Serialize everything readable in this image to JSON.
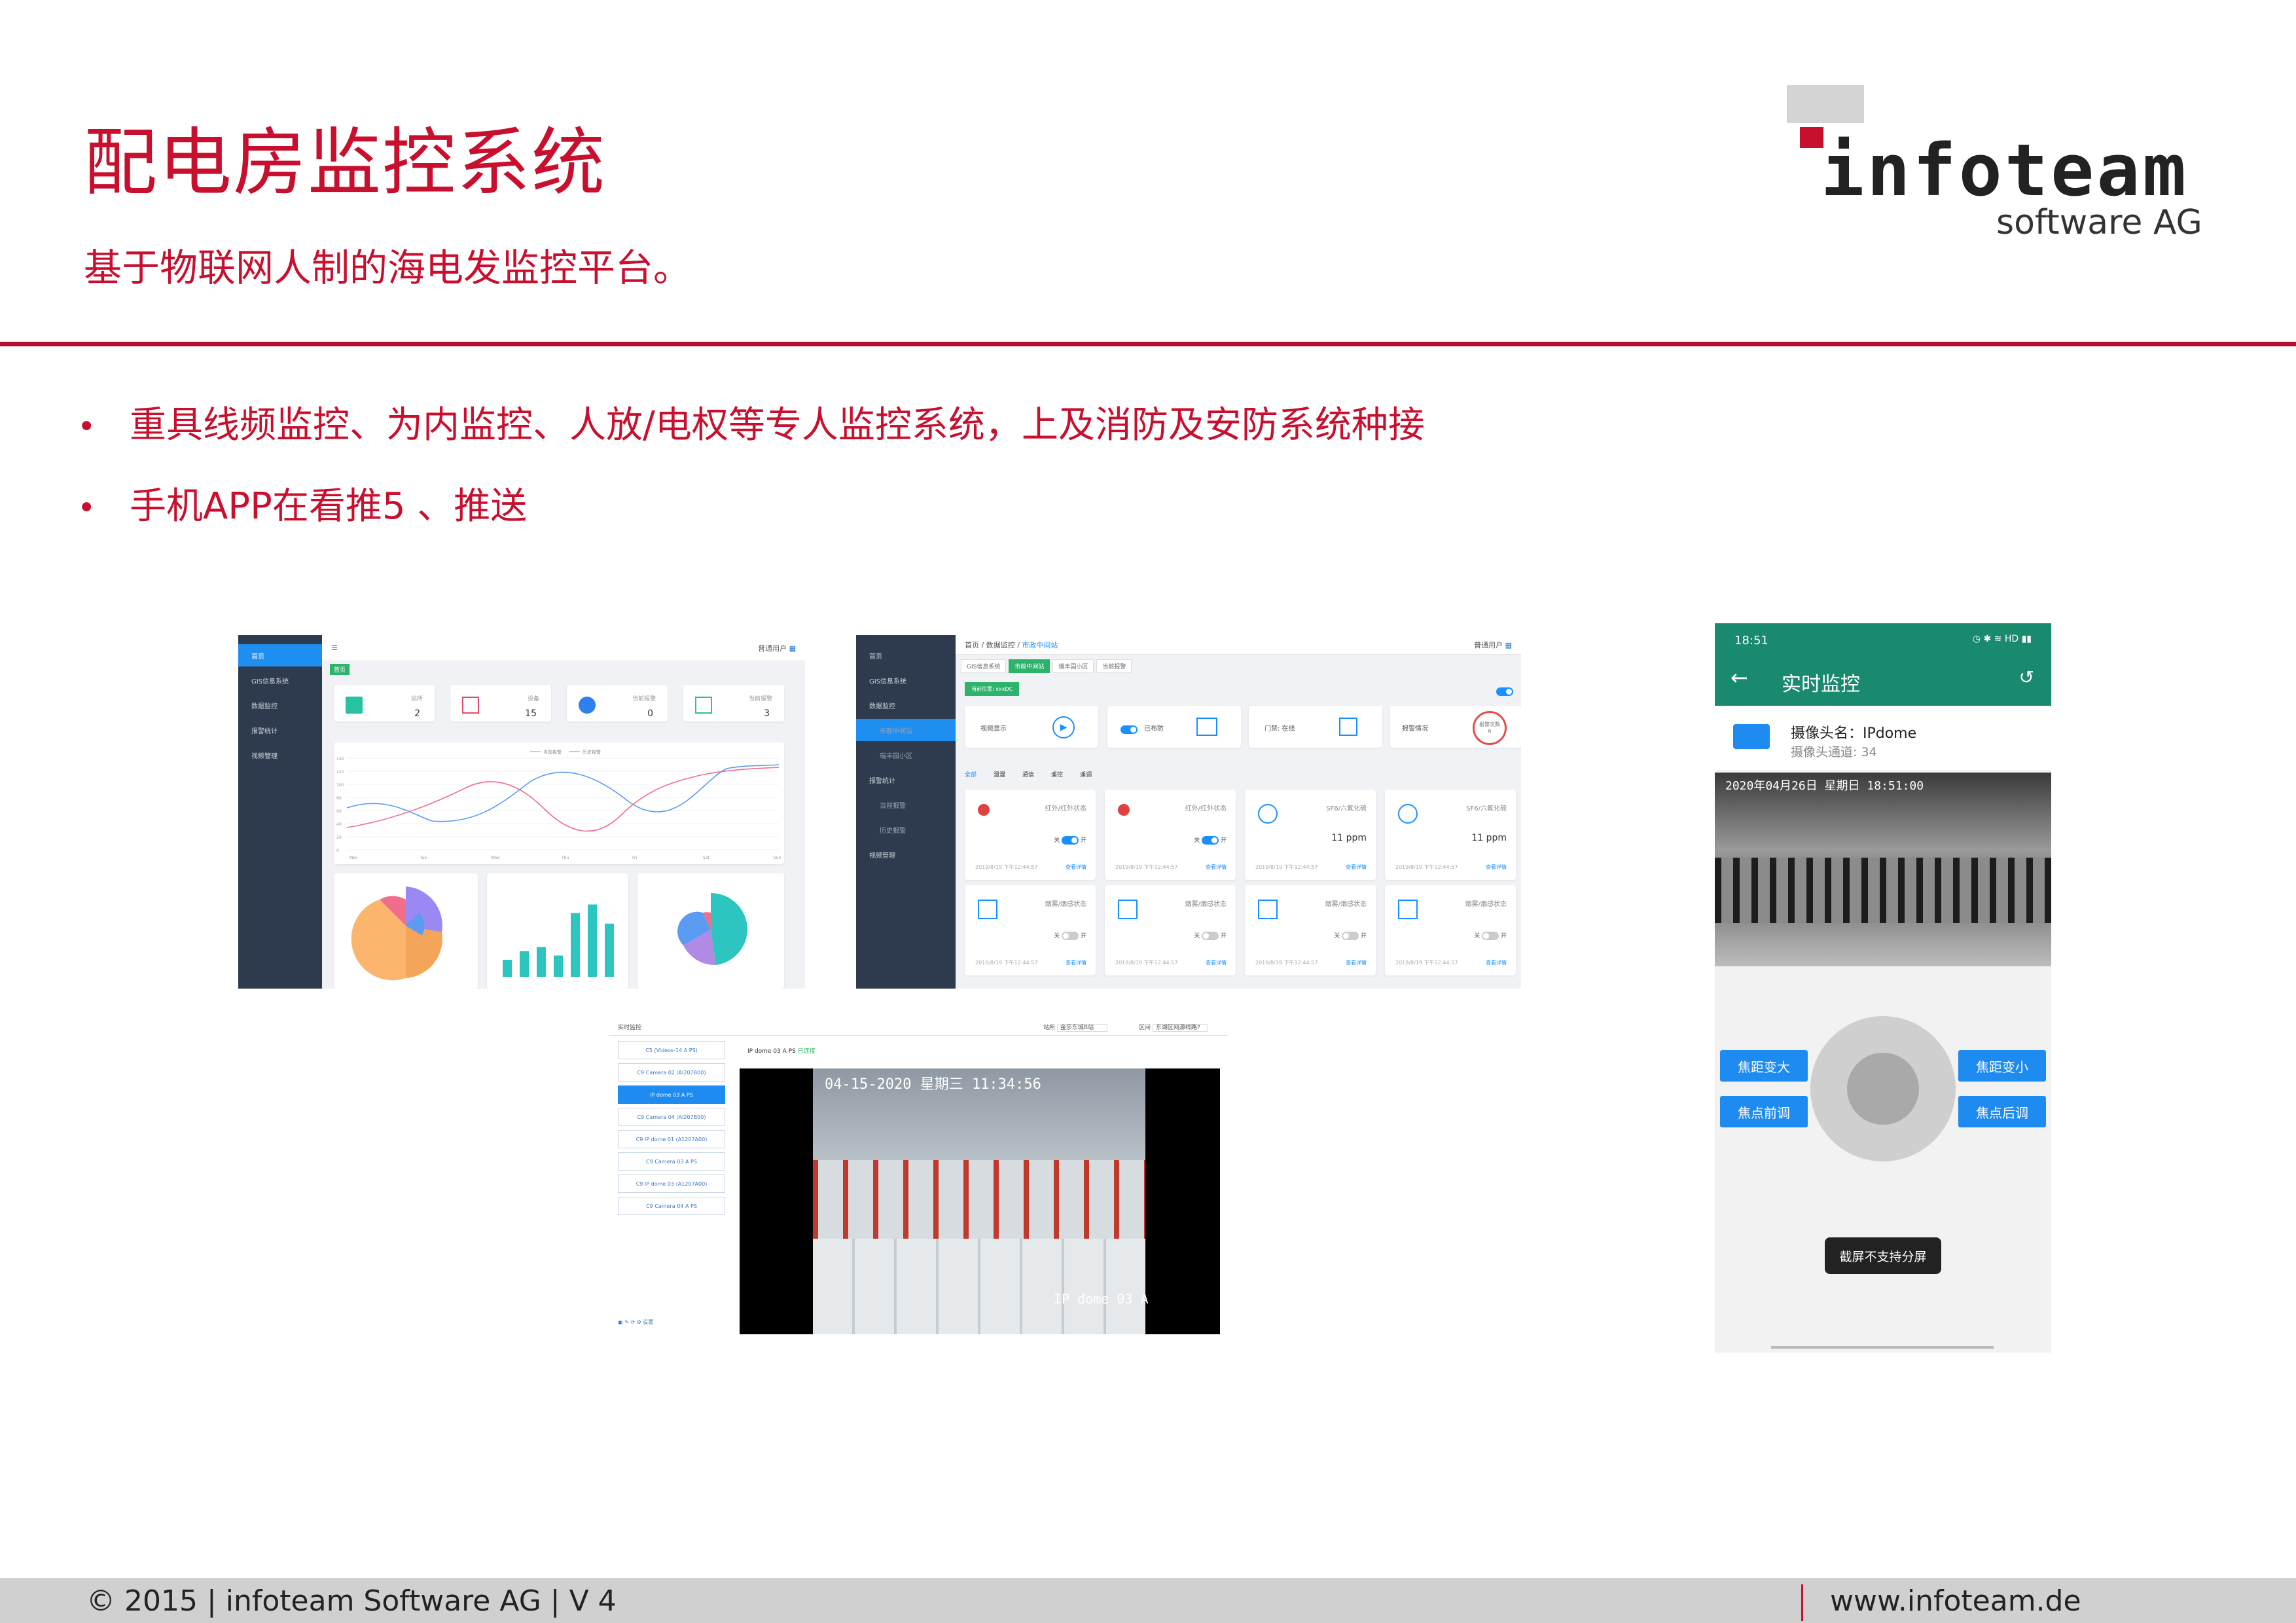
{
  "slide": {
    "title": "配电房监控系统",
    "subtitle": "基于物联网人制的海电发监控平台。",
    "bullets": [
      "重具线频监控、为内监控、人放/电权等专人监控系统，上及消防及安防系统种接",
      "手机APP在看推5 、推送"
    ],
    "bullet_char": "•"
  },
  "logo": {
    "wordmark": "infoteam",
    "tagline": "software AG"
  },
  "footer": {
    "left": "© 2015 | infoteam Software AG | V 4",
    "right": "www.infoteam.de"
  },
  "dashboard": {
    "user": "普通用户",
    "sidebar": [
      "首页",
      "GIS信息系统",
      "数据监控",
      "报警统计",
      "视频管理"
    ],
    "tab": "首页",
    "stats": [
      {
        "label": "站所",
        "value": "2"
      },
      {
        "label": "设备",
        "value": "15"
      },
      {
        "label": "当前报警",
        "value": "0"
      },
      {
        "label": "当前报警",
        "value": "3"
      }
    ],
    "legend": [
      "当前报警",
      "历史报警"
    ],
    "x_labels": [
      "Mon",
      "Tue",
      "Wed",
      "Thu",
      "Fri",
      "Sat",
      "Sun"
    ],
    "y_labels": [
      "140",
      "120",
      "100",
      "80",
      "60",
      "40",
      "20",
      "0"
    ],
    "series_colors": {
      "a": "#f06e8c",
      "b": "#5b9cf2"
    },
    "bar_chart": {
      "values": [
        8,
        12,
        14,
        10,
        30,
        34,
        25
      ],
      "max": 40
    },
    "bar_color": "#2cc5c0"
  },
  "monitor": {
    "user": "普通用户",
    "breadcrumb": [
      "首页",
      "数据监控",
      "市政中间站"
    ],
    "sidebar": [
      "首页",
      "GIS信息系统",
      "数据监控",
      "市政中间站",
      "瑞丰园小区",
      "报警统计",
      "当前报警",
      "历史报警",
      "视频管理"
    ],
    "tabs": [
      "GIS信息系统",
      "市政中间站",
      "瑞丰园小区",
      "当前报警"
    ],
    "location_tag": "当前位置: xxxDC",
    "summary": {
      "video": "视频显示",
      "armed": "已布防",
      "door": "门禁: 在线",
      "alarm": "报警情况",
      "alarm_count": "报警次数",
      "alarm_num": "6"
    },
    "filter_tabs": [
      "全部",
      "温湿",
      "通信",
      "遥控",
      "遥调"
    ],
    "devices": [
      {
        "title": "红外/红外状态",
        "type": "switch",
        "on": true
      },
      {
        "title": "红外/红外状态",
        "type": "switch",
        "on": true
      },
      {
        "title": "SF6/六氟化硫",
        "type": "value",
        "value": "11",
        "unit": "ppm"
      },
      {
        "title": "SF6/六氟化硫",
        "type": "value",
        "value": "11",
        "unit": "ppm"
      },
      {
        "title": "烟雾/烟感状态",
        "type": "switch",
        "on": false
      },
      {
        "title": "烟雾/烟感状态",
        "type": "switch",
        "on": false
      },
      {
        "title": "烟雾/烟感状态",
        "type": "switch",
        "on": false
      },
      {
        "title": "烟雾/烟感状态",
        "type": "switch",
        "on": false
      }
    ],
    "switch_off": "关",
    "switch_on": "开",
    "time": "2019/8/19 下午12:44:57",
    "detail": "查看详情"
  },
  "video": {
    "title": "实时监控",
    "filter_a_label": "站所",
    "filter_a_value": "金莎东城B站",
    "filter_b_label": "区间",
    "filter_b_value": "东湖区网源线路?",
    "cameras": [
      "C5 (Videos-14 A PS)",
      "C9 Camera 02 (AI207B00)",
      "IP dome 03 A PS",
      "C9 Camera 04 (AI207B00)",
      "C9 IP dome 01 (A1207A00)",
      "C9 Camera 03 A PS",
      "C9 IP dome 03 (A1207A00)",
      "C9 Camera 04 A PS"
    ],
    "active_index": 2,
    "stream_label": "IP dome 03 A PS",
    "stream_status": "已连接",
    "osd_time": "04-15-2020 星期三 11:34:56",
    "osd_name": "IP dome 03 A"
  },
  "phone": {
    "status_time": "18:51",
    "title": "实时监控",
    "camera_name": "摄像头名：IPdome",
    "camera_channel": "摄像头通道: 34",
    "osd_time": "2020年04月26日 星期日 18:51:00",
    "buttons": [
      "焦距变大",
      "焦点前调",
      "焦距变小",
      "焦点后调"
    ],
    "toast": "截屏不支持分屏",
    "accent": "#1a8a6e"
  }
}
